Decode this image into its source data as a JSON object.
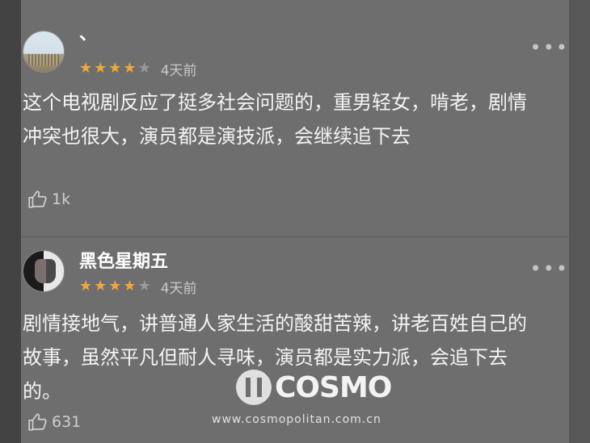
{
  "comments": [
    {
      "username": "、",
      "stars_filled": 4,
      "stars_total": 5,
      "time": "4天前",
      "text": "这个电视剧反应了挺多社会问题的，重男轻女，啃老，剧情冲突也很大，演员都是演技派，会继续追下去",
      "likes": "1k",
      "more": "•••"
    },
    {
      "username": "黑色星期五",
      "stars_filled": 4,
      "stars_total": 5,
      "time": "4天前",
      "text": "剧情接地气，讲普通人家生活的酸甜苦辣，讲老百姓自己的故事，虽然平凡但耐人寻味，演员都是实力派，会追下去的。",
      "likes": "631",
      "more": "•••"
    }
  ],
  "watermark": {
    "logo_text": "COSMO",
    "url": "www.cosmopolitan.com.cn"
  },
  "icons": {
    "star": "star-icon",
    "like": "thumbs-up-icon",
    "more": "more-dots-icon"
  },
  "colors": {
    "star_on": "#f0a83a",
    "star_off": "#9a9a9a",
    "background": "#6e6e6f"
  }
}
